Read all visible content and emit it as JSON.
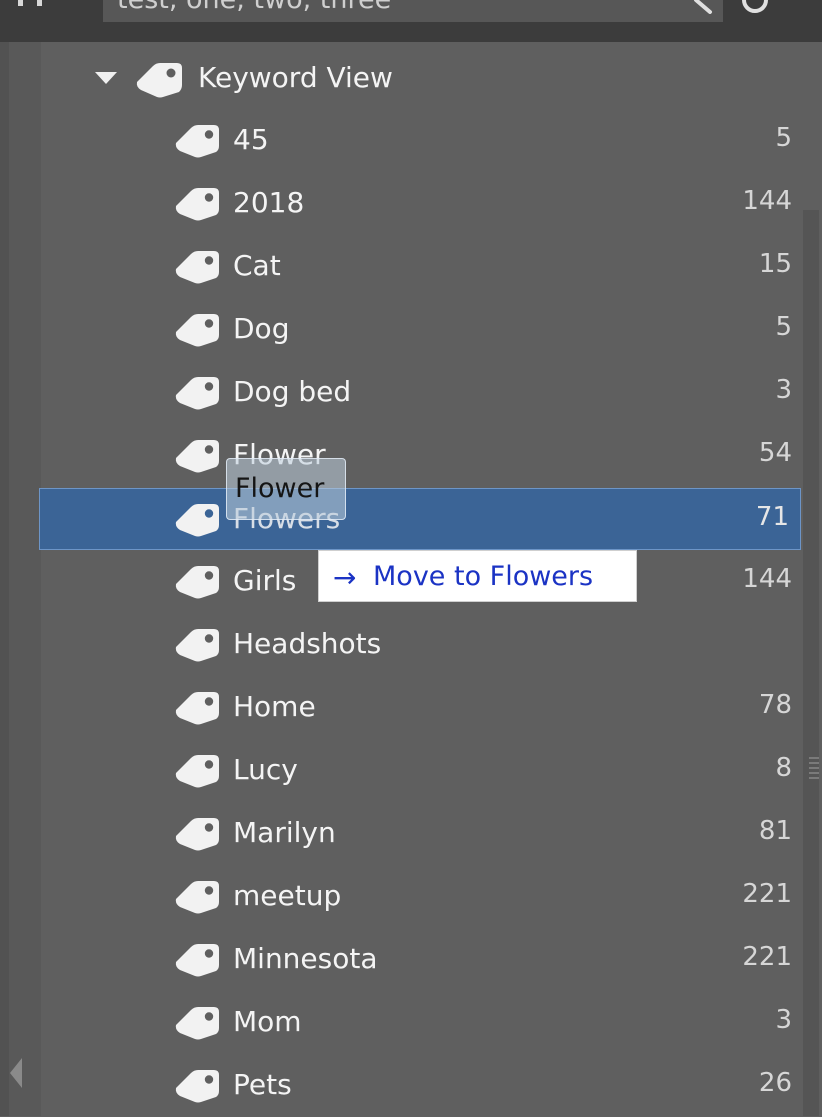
{
  "search": {
    "value": "test, one, two, three"
  },
  "tree": {
    "parent": {
      "label": "Keyword View",
      "expanded": true
    },
    "items": [
      {
        "label": "45",
        "count": "5"
      },
      {
        "label": "2018",
        "count": "144"
      },
      {
        "label": "Cat",
        "count": "15"
      },
      {
        "label": "Dog",
        "count": "5"
      },
      {
        "label": "Dog bed",
        "count": "3"
      },
      {
        "label": "Flower",
        "count": "54"
      },
      {
        "label": "Flowers",
        "count": "71",
        "selected": true
      },
      {
        "label": "Girls",
        "count": "144"
      },
      {
        "label": "Headshots",
        "count": ""
      },
      {
        "label": "Home",
        "count": "78"
      },
      {
        "label": "Lucy",
        "count": "8"
      },
      {
        "label": "Marilyn",
        "count": "81"
      },
      {
        "label": "meetup",
        "count": "221"
      },
      {
        "label": "Minnesota",
        "count": "221"
      },
      {
        "label": "Mom",
        "count": "3"
      },
      {
        "label": "Pets",
        "count": "26"
      }
    ]
  },
  "drag": {
    "ghost_label": "Flower",
    "tooltip_arrow": "→",
    "tooltip_text": "Move to Flowers"
  },
  "colors": {
    "background": "#5f5f5f",
    "selection": "#3b6496",
    "tooltip_text": "#1b33c4"
  },
  "icons": {
    "item": "tag-icon",
    "expand": "triangle-down-icon",
    "search": "search-icon",
    "refresh": "refresh-icon"
  }
}
